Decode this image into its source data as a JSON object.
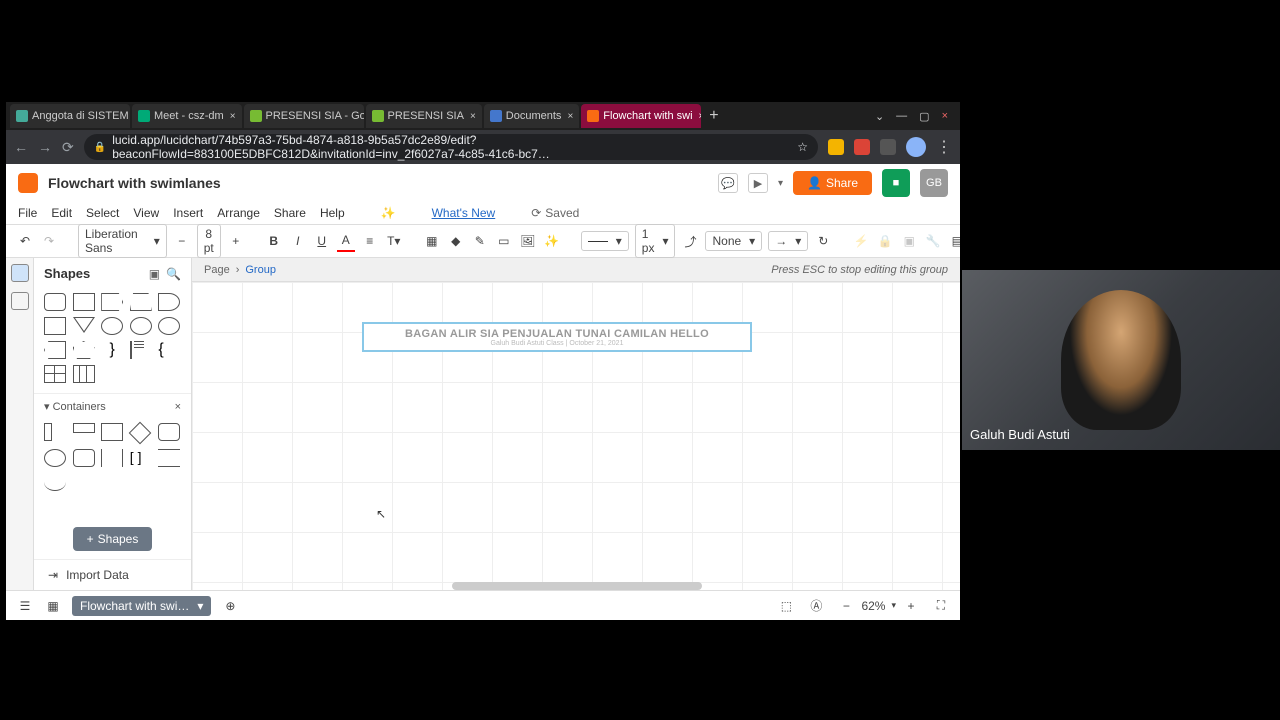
{
  "browser": {
    "tabs": [
      {
        "label": "Anggota di SISTEM"
      },
      {
        "label": "Meet - csz-dm"
      },
      {
        "label": "PRESENSI SIA - Go"
      },
      {
        "label": "PRESENSI SIA"
      },
      {
        "label": "Documents"
      },
      {
        "label": "Flowchart with swi"
      }
    ],
    "url": "lucid.app/lucidchart/74b597a3-75bd-4874-a818-9b5a57dc2e89/edit?beaconFlowId=883100E5DBFC812D&invitationId=inv_2f6027a7-4c85-41c6-bc7…"
  },
  "app": {
    "doc_title": "Flowchart with swimlanes",
    "menu": [
      "File",
      "Edit",
      "Select",
      "View",
      "Insert",
      "Arrange",
      "Share",
      "Help"
    ],
    "whats_new": "What's New",
    "saved": "Saved",
    "share": "Share",
    "avatar_initials": "GB"
  },
  "toolbar": {
    "font": "Liberation Sans",
    "size": "8 pt",
    "line_style": "None",
    "line_width": "1 px"
  },
  "sidebar": {
    "shapes_title": "Shapes",
    "containers_title": "Containers",
    "shapes_btn": "Shapes",
    "import": "Import Data"
  },
  "breadcrumb": {
    "page": "Page",
    "group": "Group",
    "hint": "Press ESC to stop editing this group"
  },
  "canvas": {
    "title": "BAGAN ALIR SIA PENJUALAN TUNAI CAMILAN HELLO",
    "subtitle": "Galuh Budi Astuti Class  |  October 21, 2021"
  },
  "bottom": {
    "page_name": "Flowchart with swi…",
    "zoom": "62%"
  },
  "video": {
    "name": "Galuh Budi Astuti"
  }
}
